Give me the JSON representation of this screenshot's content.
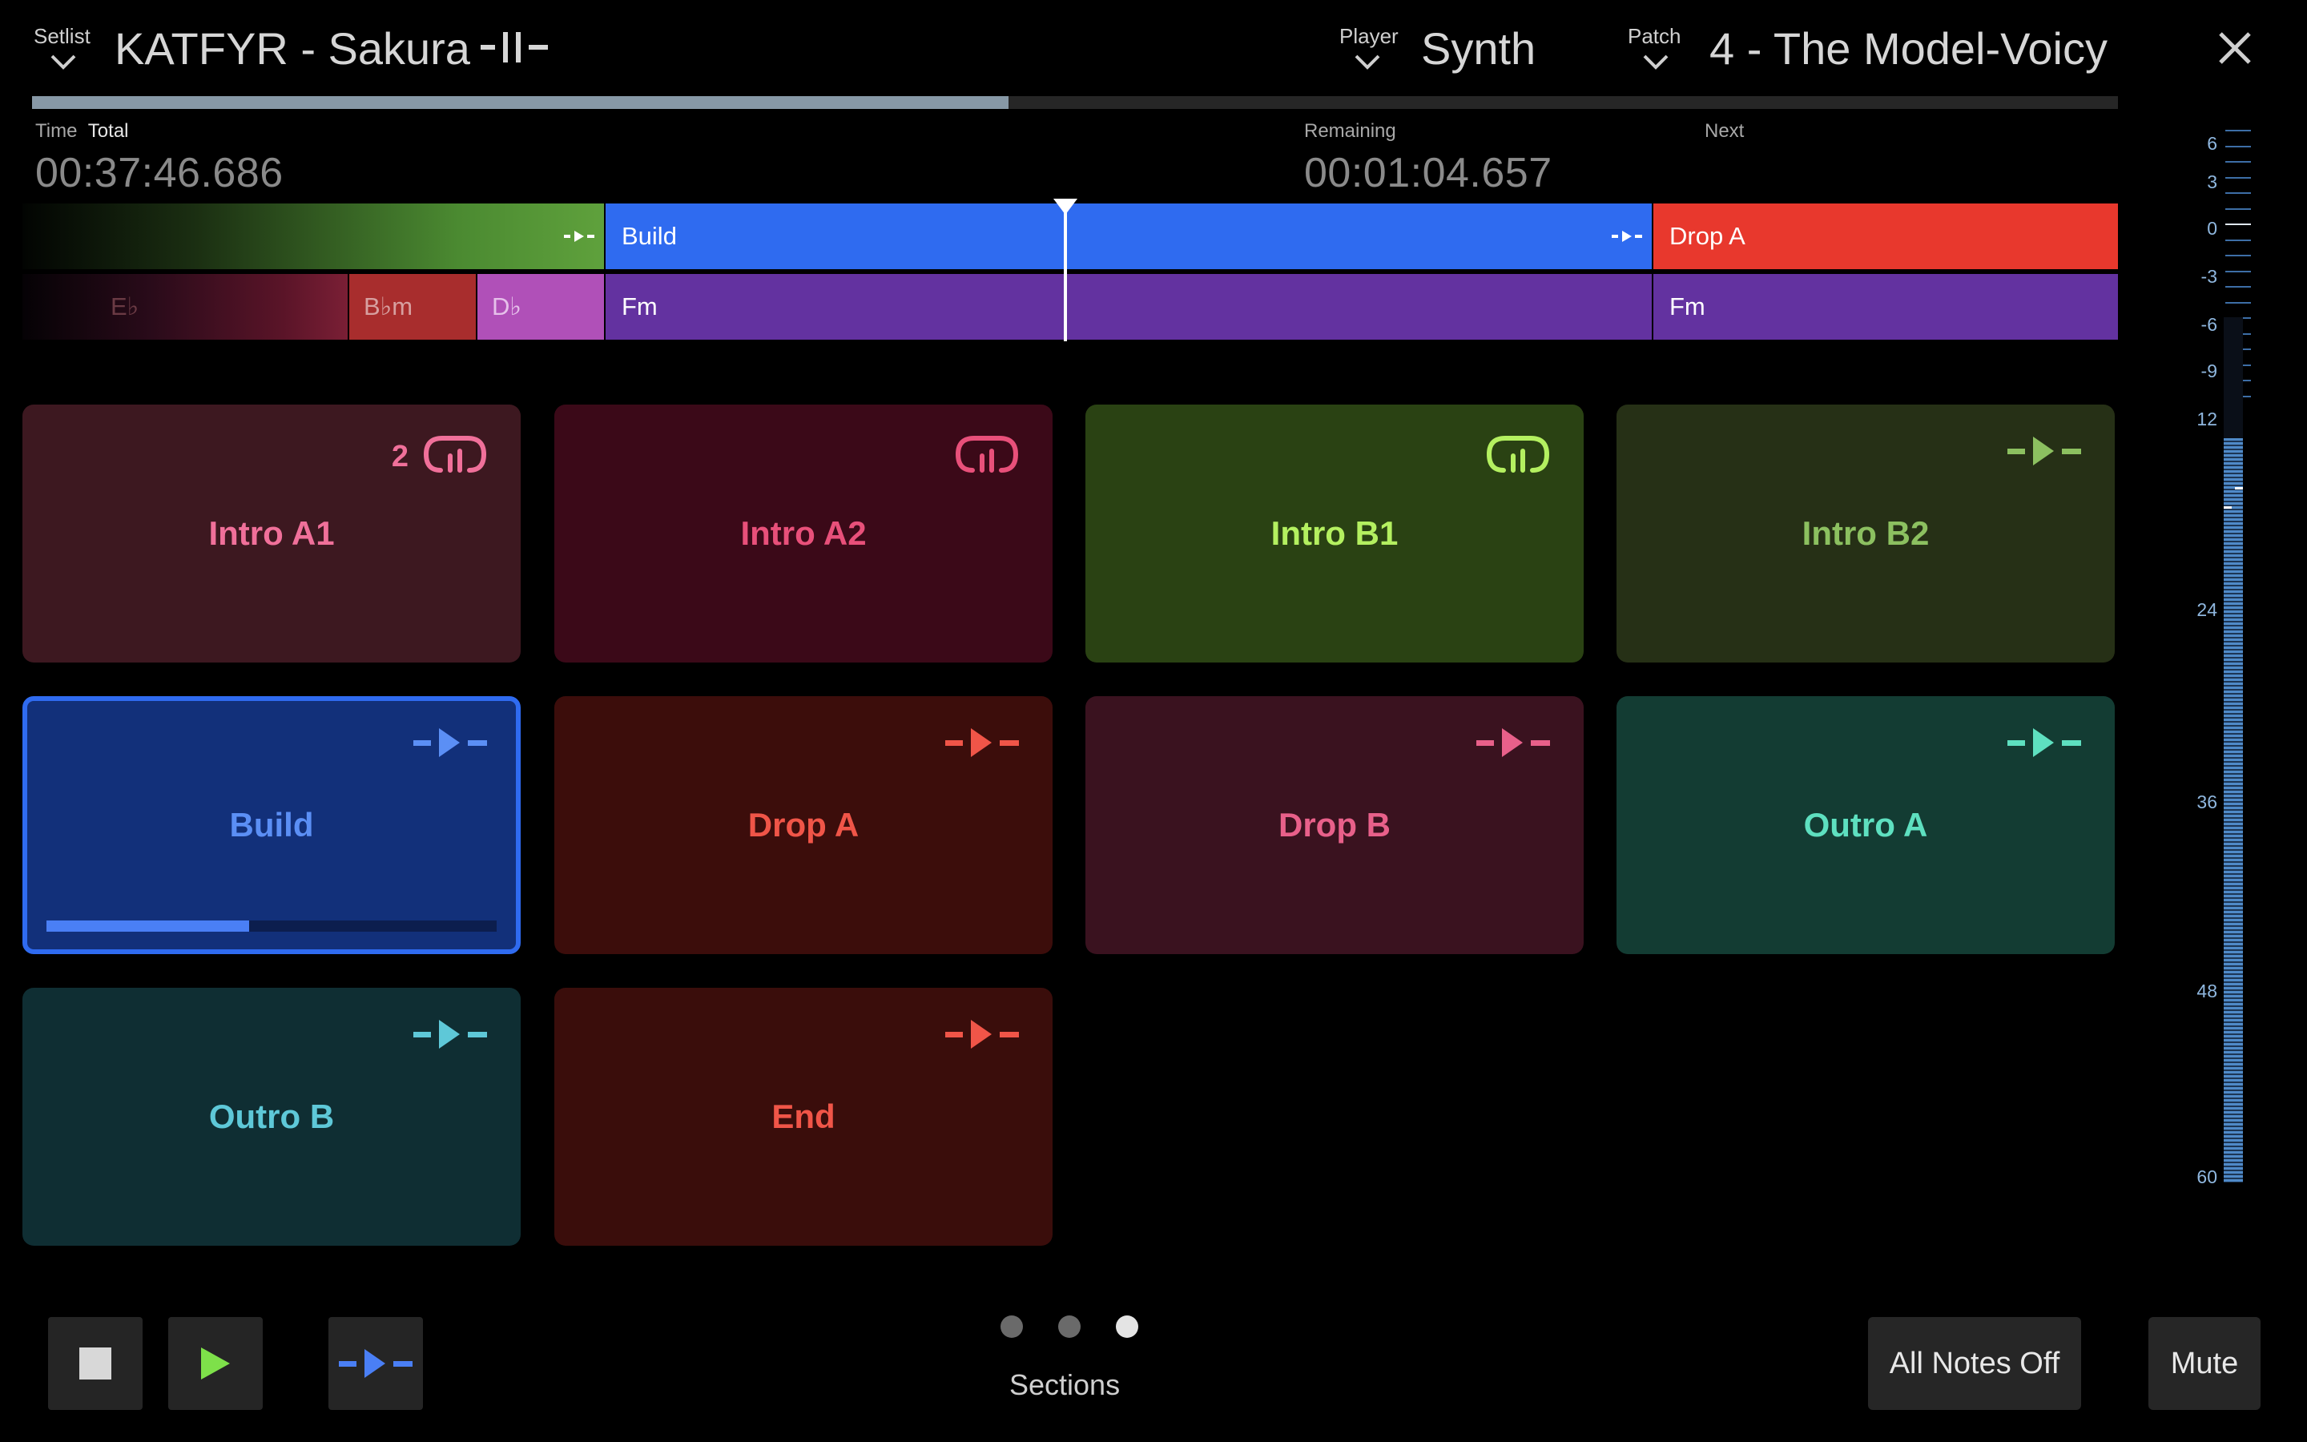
{
  "header": {
    "setlist_label": "Setlist",
    "song_title": "KATFYR - Sakura",
    "player_label": "Player",
    "player_value": "Synth",
    "patch_label": "Patch",
    "patch_value": "4 - The Model-Voicy"
  },
  "progress": {
    "song_fraction": 0.468
  },
  "time": {
    "time_label": "Time",
    "total_label": "Total",
    "total_value": "00:37:46.686",
    "remaining_label": "Remaining",
    "remaining_value": "00:01:04.657",
    "next_label": "Next"
  },
  "timeline": {
    "sections": [
      {
        "label": "",
        "color": "#5fa13c"
      },
      {
        "label": "Build",
        "color": "#2f6bf0"
      },
      {
        "label": "Drop A",
        "color": "#e8382d"
      }
    ],
    "chords": [
      {
        "label": "E♭",
        "color": "#7a1f35"
      },
      {
        "label": "B♭m",
        "color": "#b03030"
      },
      {
        "label": "D♭",
        "color": "#b050b8"
      },
      {
        "label": "Fm",
        "color": "#6332a0"
      },
      {
        "label": "Fm",
        "color": "#6332a0"
      }
    ]
  },
  "pads": [
    {
      "label": "Intro A1",
      "icon": "loop-icon",
      "count": "2",
      "bg": "#3d1820",
      "fg": "#f0709a"
    },
    {
      "label": "Intro A2",
      "icon": "loop-icon",
      "count": "",
      "bg": "#3b0918",
      "fg": "#e8507a"
    },
    {
      "label": "Intro B1",
      "icon": "loop-icon",
      "count": "",
      "bg": "#2a4213",
      "fg": "#b4f060"
    },
    {
      "label": "Intro B2",
      "icon": "play-next-icon",
      "count": "",
      "bg": "#263016",
      "fg": "#8cc060"
    },
    {
      "label": "Build",
      "icon": "play-next-icon",
      "count": "",
      "bg": "#12307a",
      "fg": "#5b8ff5",
      "progress": 0.45
    },
    {
      "label": "Drop A",
      "icon": "play-next-icon",
      "count": "",
      "bg": "#3c0d0b",
      "fg": "#f05548"
    },
    {
      "label": "Drop B",
      "icon": "play-next-icon",
      "count": "",
      "bg": "#3a121f",
      "fg": "#e8608a"
    },
    {
      "label": "Outro A",
      "icon": "play-next-icon",
      "count": "",
      "bg": "#133c33",
      "fg": "#5ee0c0"
    },
    {
      "label": "Outro B",
      "icon": "play-next-icon",
      "count": "",
      "bg": "#0f2e33",
      "fg": "#5ec8d8"
    },
    {
      "label": "End",
      "icon": "play-next-icon",
      "count": "",
      "bg": "#3a0d0b",
      "fg": "#f05548"
    }
  ],
  "meter": {
    "labels": [
      "6",
      "3",
      "0",
      "-3",
      "-6",
      "-9",
      "12",
      "24",
      "36",
      "48",
      "60"
    ],
    "level_fraction": 0.86
  },
  "bottom": {
    "page_dots": 3,
    "active_page": 3,
    "page_label": "Sections",
    "all_notes_off": "All Notes Off",
    "mute": "Mute"
  },
  "colors": {
    "accent_blue": "#2f6bf0",
    "play_green": "#7ee04a",
    "selected_border": "#2f6bf0"
  }
}
